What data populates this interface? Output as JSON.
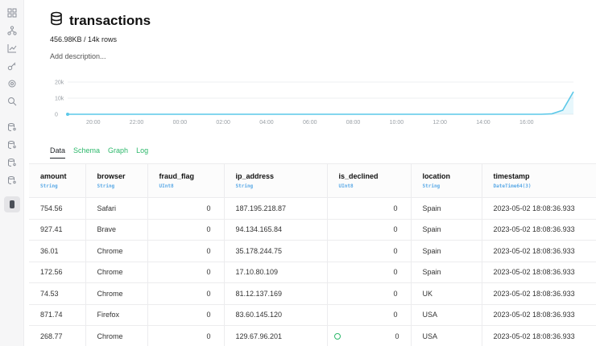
{
  "sidebar": {
    "items": [
      {
        "icon": "grid-icon"
      },
      {
        "icon": "nodes-icon"
      },
      {
        "icon": "chart-icon"
      },
      {
        "icon": "key-icon"
      },
      {
        "icon": "settings-icon"
      },
      {
        "icon": "search-icon"
      },
      {
        "icon": "db-user-icon"
      },
      {
        "icon": "db-user-icon"
      },
      {
        "icon": "db-user-icon"
      },
      {
        "icon": "db-user-icon"
      },
      {
        "icon": "database-icon",
        "active": true
      }
    ]
  },
  "header": {
    "title": "transactions",
    "meta": "456.98KB / 14k rows",
    "description_placeholder": "Add description..."
  },
  "chart_data": {
    "type": "area",
    "y_ticks": [
      "20k",
      "10k",
      "0"
    ],
    "x_ticks": [
      "20:00",
      "22:00",
      "00:00",
      "02:00",
      "04:00",
      "06:00",
      "08:00",
      "10:00",
      "12:00",
      "14:00",
      "16:00"
    ],
    "ylim": [
      0,
      20000
    ],
    "series": [
      {
        "values": [
          0,
          0,
          0,
          0,
          0,
          0,
          0,
          0,
          0,
          0,
          0,
          300,
          2500,
          14000
        ]
      }
    ],
    "color": "#5cc8e8"
  },
  "tabs": [
    {
      "label": "Data",
      "active": true
    },
    {
      "label": "Schema"
    },
    {
      "label": "Graph"
    },
    {
      "label": "Log"
    }
  ],
  "table": {
    "columns": [
      {
        "name": "amount",
        "type": "String"
      },
      {
        "name": "browser",
        "type": "String"
      },
      {
        "name": "fraud_flag",
        "type": "UInt8"
      },
      {
        "name": "ip_address",
        "type": "String"
      },
      {
        "name": "is_declined",
        "type": "UInt8"
      },
      {
        "name": "location",
        "type": "String"
      },
      {
        "name": "timestamp",
        "type": "DateTime64(3)"
      }
    ],
    "rows": [
      [
        "754.56",
        "Safari",
        "0",
        "187.195.218.87",
        "0",
        "Spain",
        "2023-05-02 18:08:36.933"
      ],
      [
        "927.41",
        "Brave",
        "0",
        "94.134.165.84",
        "0",
        "Spain",
        "2023-05-02 18:08:36.933"
      ],
      [
        "36.01",
        "Chrome",
        "0",
        "35.178.244.75",
        "0",
        "Spain",
        "2023-05-02 18:08:36.933"
      ],
      [
        "172.56",
        "Chrome",
        "0",
        "17.10.80.109",
        "0",
        "Spain",
        "2023-05-02 18:08:36.933"
      ],
      [
        "74.53",
        "Chrome",
        "0",
        "81.12.137.169",
        "0",
        "UK",
        "2023-05-02 18:08:36.933"
      ],
      [
        "871.74",
        "Firefox",
        "0",
        "83.60.145.120",
        "0",
        "USA",
        "2023-05-02 18:08:36.933"
      ],
      [
        "268.77",
        "Chrome",
        "0",
        "129.67.96.201",
        "0",
        "USA",
        "2023-05-02 18:08:36.933"
      ]
    ]
  },
  "colors": {
    "accent": "#2db86b",
    "chart": "#5cc8e8",
    "type_label": "#5aa9e6"
  }
}
